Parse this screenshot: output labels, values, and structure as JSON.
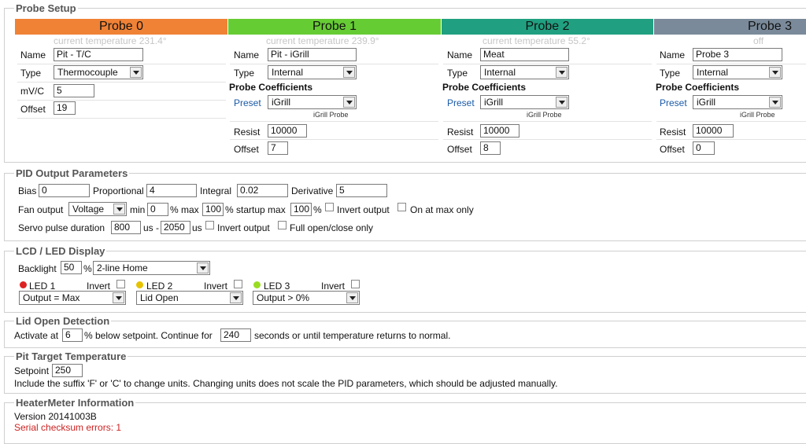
{
  "probe_setup": {
    "legend": "Probe Setup",
    "probes": [
      {
        "header": "Probe 0",
        "color": "#f08236",
        "status": "current temperature 231.4°",
        "name_label": "Name",
        "name": "Pit - T/C",
        "type_label": "Type",
        "type": "Thermocouple",
        "mvc_label": "mV/C",
        "mvc": "5",
        "offset_label": "Offset",
        "offset": "19"
      },
      {
        "header": "Probe 1",
        "color": "#66cc33",
        "status": "current temperature 239.9°",
        "name_label": "Name",
        "name": "Pit - iGrill",
        "type_label": "Type",
        "type": "Internal",
        "coef_label": "Probe Coefficients",
        "preset_label": "Preset",
        "preset": "iGrill",
        "preset_note": "iGrill Probe",
        "resist_label": "Resist",
        "resist": "10000",
        "offset_label": "Offset",
        "offset": "7"
      },
      {
        "header": "Probe 2",
        "color": "#20a080",
        "status": "current temperature 55.2°",
        "name_label": "Name",
        "name": "Meat",
        "type_label": "Type",
        "type": "Internal",
        "coef_label": "Probe Coefficients",
        "preset_label": "Preset",
        "preset": "iGrill",
        "preset_note": "iGrill Probe",
        "resist_label": "Resist",
        "resist": "10000",
        "offset_label": "Offset",
        "offset": "8"
      },
      {
        "header": "Probe 3",
        "color": "#7a8a9a",
        "status": "off",
        "name_label": "Name",
        "name": "Probe 3",
        "type_label": "Type",
        "type": "Internal",
        "coef_label": "Probe Coefficients",
        "preset_label": "Preset",
        "preset": "iGrill",
        "preset_note": "iGrill Probe",
        "resist_label": "Resist",
        "resist": "10000",
        "offset_label": "Offset",
        "offset": "0"
      }
    ]
  },
  "pid": {
    "legend": "PID Output Parameters",
    "bias_label": "Bias",
    "bias": "0",
    "prop_label": "Proportional",
    "prop": "4",
    "integral_label": "Integral",
    "integral": "0.02",
    "deriv_label": "Derivative",
    "deriv": "5",
    "fan_label": "Fan output",
    "fan_mode": "Voltage",
    "min_label": "min",
    "min": "0",
    "pct1": "% max",
    "max": "100",
    "pct2": "% startup max",
    "startup_max": "100",
    "pct3": "%",
    "invert_label": "Invert output",
    "onmax_label": "On at max only",
    "servo_label": "Servo pulse duration",
    "servo_min": "800",
    "us_dash": "us -",
    "servo_max": "2050",
    "us": "us",
    "servo_invert_label": "Invert output",
    "full_label": "Full open/close only"
  },
  "lcd": {
    "legend": "LCD / LED Display",
    "backlight_label": "Backlight",
    "backlight": "50",
    "pct": "%",
    "mode": "2-line Home",
    "leds": [
      {
        "label": "LED 1",
        "color": "#dd2222",
        "invert": "Invert",
        "value": "Output = Max"
      },
      {
        "label": "LED 2",
        "color": "#e6c200",
        "invert": "Invert",
        "value": "Lid Open"
      },
      {
        "label": "LED 3",
        "color": "#99dd22",
        "invert": "Invert",
        "value": "Output > 0%"
      }
    ]
  },
  "lid": {
    "legend": "Lid Open Detection",
    "activate_label": "Activate at",
    "activate": "6",
    "continue_text": "% below setpoint. Continue for",
    "seconds": "240",
    "tail_text": "seconds or until temperature returns to normal."
  },
  "pit": {
    "legend": "Pit Target Temperature",
    "setpoint_label": "Setpoint",
    "setpoint": "250",
    "hint": "Include the suffix 'F' or 'C' to change units. Changing units does not scale the PID parameters, which should be adjusted manually."
  },
  "info": {
    "legend": "HeaterMeter Information",
    "version": "Version 20141003B",
    "errors": "Serial checksum errors: 1",
    "error_color": "#cc2222"
  }
}
